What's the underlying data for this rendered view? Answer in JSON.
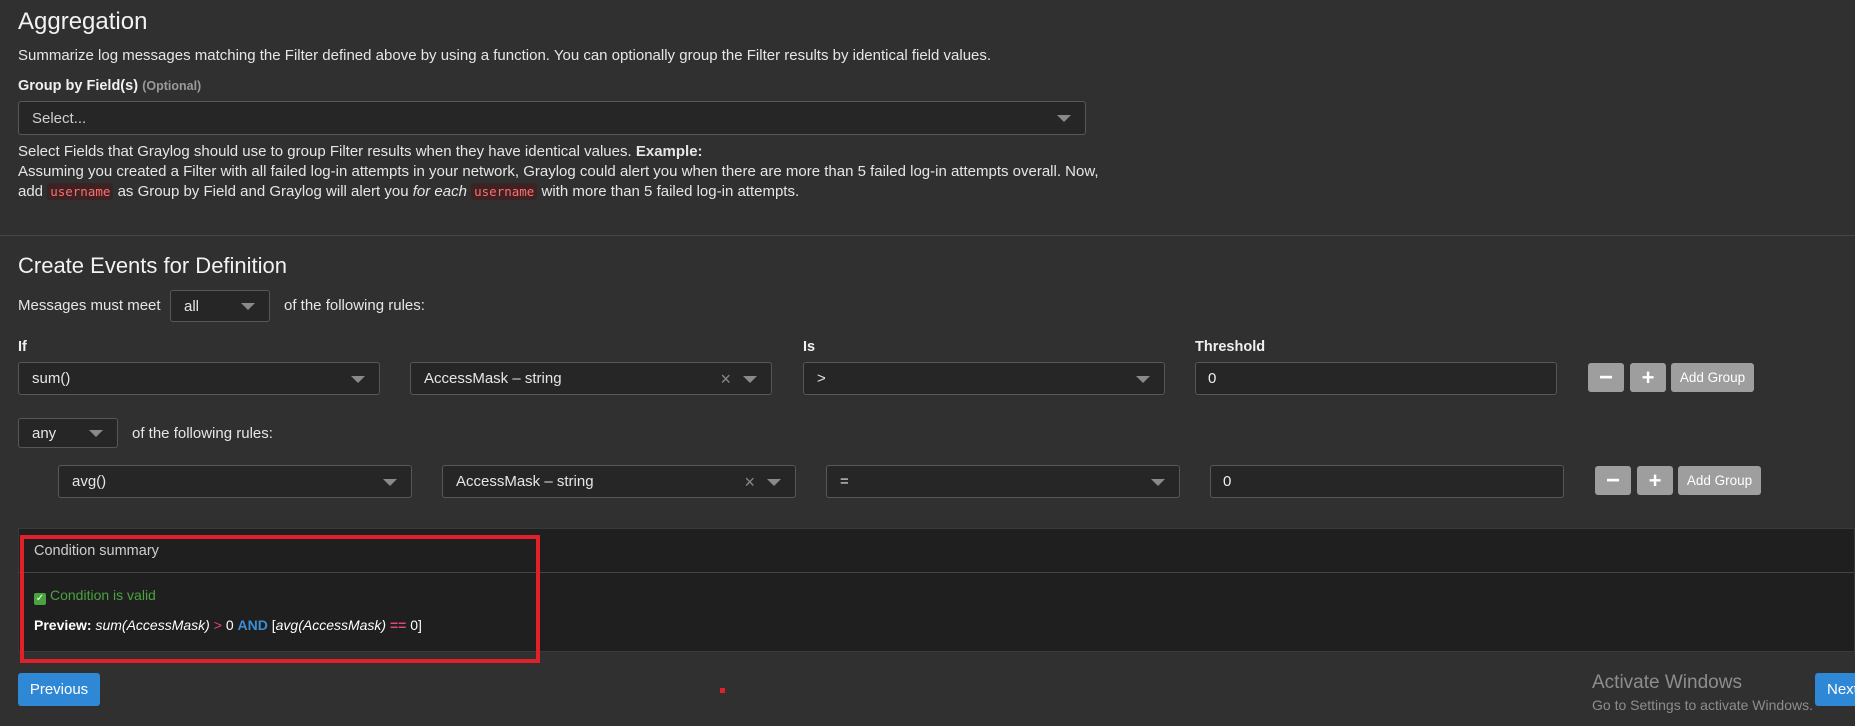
{
  "aggregation": {
    "title": "Aggregation",
    "description": "Summarize log messages matching the Filter defined above by using a function. You can optionally group the Filter results by identical field values.",
    "group_by_label": "Group by Field(s)",
    "group_by_optional": "(Optional)",
    "group_by_placeholder": "Select...",
    "help_line1_text": "Select Fields that Graylog should use to group Filter results when they have identical values.",
    "help_line1_bold": "Example:",
    "help_line2": "Assuming you created a Filter with all failed log-in attempts in your network, Graylog could alert you when there are more than 5 failed log-in attempts overall. Now,",
    "help_line3_a": "add",
    "help_line3_code1": "username",
    "help_line3_b": "as Group by Field and Graylog will alert you",
    "help_line3_em": "for each",
    "help_line3_code2": "username",
    "help_line3_c": "with more than 5 failed log-in attempts."
  },
  "events": {
    "title": "Create Events for Definition",
    "messages_must_meet": "Messages must meet",
    "match_mode": "all",
    "following_rules": "of the following rules:",
    "col_if": "If",
    "col_is": "Is",
    "col_threshold": "Threshold",
    "rule1": {
      "function": "sum()",
      "field": "AccessMask – string",
      "operator": ">",
      "threshold": "0"
    },
    "group_match_mode": "any",
    "group_following_rules": "of the following rules:",
    "rule2": {
      "function": "avg()",
      "field": "AccessMask – string",
      "operator": "=",
      "threshold": "0"
    },
    "btn_minus": "−",
    "btn_plus": "+",
    "btn_add_group": "Add Group"
  },
  "summary": {
    "title": "Condition summary",
    "valid_text": "Condition is valid",
    "preview_label": "Preview:",
    "p1": "sum(AccessMask)",
    "p2": ">",
    "p3": "0",
    "p4": "AND",
    "p5": "[",
    "p6": "avg(AccessMask)",
    "p7": "==",
    "p8": "0]"
  },
  "footer": {
    "previous": "Previous",
    "next": "Next",
    "watermark_title": "Activate Windows",
    "watermark_sub": "Go to Settings to activate Windows."
  },
  "colors": {
    "accent": "#2f88d6",
    "valid_green": "#4aa33f",
    "annotation_red": "#e0202a",
    "operator_pink": "#e0457b",
    "and_blue": "#3a8fd6"
  }
}
